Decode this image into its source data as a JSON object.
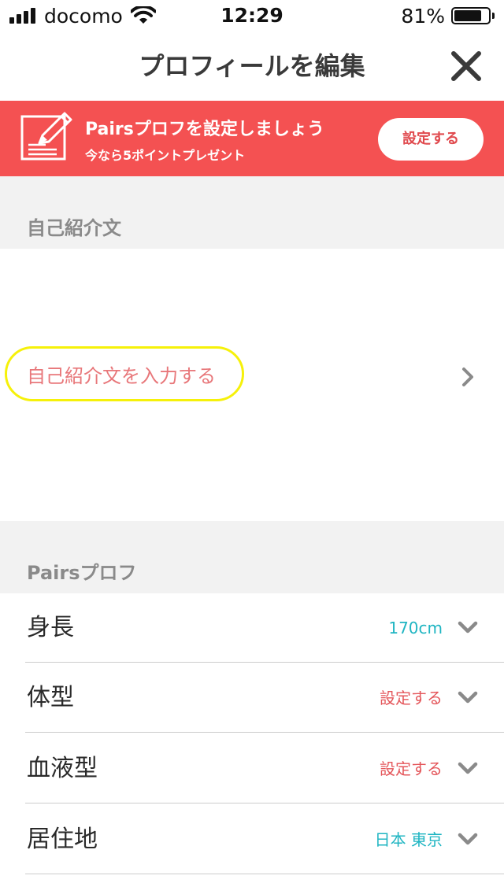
{
  "status_bar": {
    "carrier": "docomo",
    "time": "12:29",
    "battery_percent": "81%",
    "battery_level": 0.81
  },
  "nav": {
    "title": "プロフィールを編集",
    "close_icon": "close-icon"
  },
  "banner": {
    "title": "Pairsプロフを設定しましょう",
    "subtitle": "今なら5ポイントプレゼント",
    "button_label": "設定する",
    "icon": "edit-note-icon",
    "background": "#f45152"
  },
  "intro_section": {
    "header": "自己紹介文",
    "placeholder": "自己紹介文を入力する",
    "highlight_color": "#f6f10a"
  },
  "pairs_section": {
    "header": "Pairsプロフ",
    "rows": [
      {
        "label": "身長",
        "value": "170cm",
        "value_color": "#1fb5c2"
      },
      {
        "label": "体型",
        "value": "設定する",
        "value_color": "#e4565a"
      },
      {
        "label": "血液型",
        "value": "設定する",
        "value_color": "#e4565a"
      },
      {
        "label": "居住地",
        "value": "日本 東京",
        "value_color": "#1fb5c2"
      }
    ]
  }
}
